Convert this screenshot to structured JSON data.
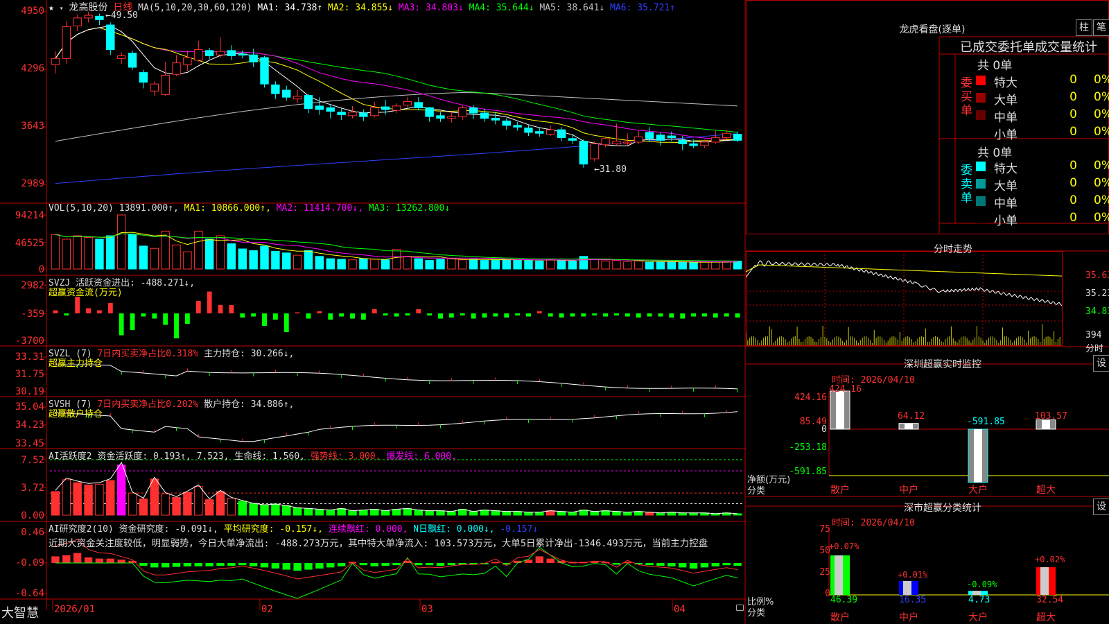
{
  "stock": {
    "name": "龙高股份",
    "period": "日线",
    "ma_label": "MA(5,10,20,30,60,120)",
    "ma": [
      {
        "label": "MA1: 34.738↑",
        "color": "#ffffff"
      },
      {
        "label": "MA2: 34.855↓",
        "color": "#ffff00"
      },
      {
        "label": "MA3: 34.803↓",
        "color": "#ff00ff"
      },
      {
        "label": "MA4: 35.644↓",
        "color": "#00ff00"
      },
      {
        "label": "MA5: 38.641↓",
        "color": "#c0c0c0"
      },
      {
        "label": "MA6: 35.721↑",
        "color": "#3040ff"
      }
    ],
    "high_marker": "49.50",
    "low_marker": "31.80"
  },
  "price_axis": [
    "4950",
    "4296",
    "3643",
    "2989"
  ],
  "vol_axis": [
    "94214",
    "46525",
    "0"
  ],
  "svzj_axis": [
    "2982",
    "-359",
    "-3700"
  ],
  "svzl_axis": [
    "33.31",
    "31.75",
    "30.19"
  ],
  "svsh_axis": [
    "35.04",
    "34.23",
    "33.45"
  ],
  "ai_axis": [
    "7.52",
    "3.72",
    "0.00"
  ],
  "ai2_axis": [
    "0.46",
    "-0.09",
    "-0.64"
  ],
  "date_axis": [
    "2026/01",
    "02",
    "03",
    "04"
  ],
  "brand": "大智慧",
  "vol_panel": {
    "title": "VOL(5,10,20)",
    "value": "13891.000↑,",
    "ma1": "MA1: 10866.000↑,",
    "ma2": "MA2: 11414.700↓,",
    "ma3": "MA3: 13262.800↓"
  },
  "svzj_panel": {
    "title": "SVZJ",
    "desc": "活跃资金进出: -488.271↓,",
    "sub": "超赢资金流(万元)"
  },
  "svzl_panel": {
    "title": "SVZL (7)",
    "desc": "7日内买卖净占比0.318%",
    "hold": "主力持仓: 30.266↓,",
    "sub": "超赢主力持仓"
  },
  "svsh_panel": {
    "title": "SVSH (7)",
    "desc": "7日内买卖净占比0.202%",
    "hold": "散户持仓: 34.886↑,",
    "sub": "超赢散户持仓"
  },
  "ai_panel": {
    "title": "AI活跃度2",
    "v1": "资金活跃度: 0.193↑, 7.523,",
    "v2": "生命线: 1.560,",
    "v3": "强势线: 3.000,",
    "v4": "爆发线: 6.000,"
  },
  "ai2_panel": {
    "title": "AI研究度2(10)",
    "v1": "资金研究度: -0.091↓,",
    "v2": "平均研究度: -0.157↓,",
    "v3": "连续飘红: 0.000,",
    "v4": "N日飘红: 0.000↓,",
    "v5": "-0.157↓",
    "commentary": "近期大资金关注度较低，明显弱势，今日大单净流出: -488.273万元，其中特大单净流入: 103.573万元，大单5日累计净出-1346.493万元，当前主力控盘"
  },
  "right": {
    "lhkp_title": "龙虎看盘(逐单)",
    "btn_zhu": "柱",
    "btn_bi": "笔",
    "tabs": "已成交委托单成交量统计",
    "buy_label": "委买单",
    "sell_label": "委卖单",
    "buy_total": "共 0单",
    "sell_total": "共 0单",
    "buy_rows": [
      {
        "name": "特大",
        "count": "0",
        "pct": "0%",
        "color": "#ff0000"
      },
      {
        "name": "大单",
        "count": "0",
        "pct": "0%",
        "color": "#990000"
      },
      {
        "name": "中单",
        "count": "0",
        "pct": "0%",
        "color": "#660000"
      },
      {
        "name": "小单",
        "count": "0",
        "pct": "0%",
        "color": "#000000"
      }
    ],
    "sell_rows": [
      {
        "name": "特大",
        "count": "0",
        "pct": "0%",
        "color": "#00ffff"
      },
      {
        "name": "大单",
        "count": "0",
        "pct": "0%",
        "color": "#009999"
      },
      {
        "name": "中单",
        "count": "0",
        "pct": "0%",
        "color": "#007777"
      },
      {
        "name": "小单",
        "count": "0",
        "pct": "0%",
        "color": "#000000"
      }
    ],
    "fs_title": "分时走势",
    "fs_axis": [
      "35.63",
      "35.23",
      "34.83"
    ],
    "fs_vol": "394",
    "fs_vol_unit": "分时",
    "sz_title": "深圳超赢实时监控",
    "sz_btn": "设",
    "sz_time": "时间: 2026/04/10",
    "sz_axis": [
      "424.16",
      "85.49",
      "0",
      "-253.18",
      "-591.85"
    ],
    "sz_unit": "净额(万元)",
    "sz_cat": "分类",
    "sz_values": [
      "424.16",
      "64.12",
      "-591.85",
      "103.57"
    ],
    "sz_categories": [
      "散户",
      "中户",
      "大户",
      "超大"
    ],
    "sc_title": "深市超赢分类统计",
    "sc_btn": "设",
    "sc_time": "时间: 2026/04/10",
    "sc_axis": [
      "75",
      "50",
      "25",
      "0"
    ],
    "sc_unit": "比例%",
    "sc_cat": "分类",
    "sc_changes": [
      "+0.07%",
      "+0.01%",
      "-0.09%",
      "+0.02%"
    ],
    "sc_values": [
      "46.39",
      "16.35",
      "4.73",
      "32.54"
    ],
    "sc_categories": [
      "散户",
      "中户",
      "大户",
      "超大"
    ]
  },
  "chart_data": [
    {
      "type": "candlestick",
      "title": "龙高股份 日线",
      "ylim": [
        29.89,
        49.5
      ],
      "candles": [
        [
          43.5,
          44.2,
          45.0,
          42.5
        ],
        [
          44.2,
          47.8,
          48.4,
          43.6
        ],
        [
          47.9,
          48.8,
          49.2,
          47.3
        ],
        [
          48.8,
          49.1,
          49.5,
          48.3
        ],
        [
          49.0,
          48.6,
          49.3,
          48.0
        ],
        [
          48.0,
          45.2,
          48.3,
          44.6
        ],
        [
          44.2,
          44.5,
          44.9,
          43.6
        ],
        [
          44.8,
          43.2,
          45.1,
          42.9
        ],
        [
          42.6,
          41.5,
          42.9,
          40.8
        ],
        [
          40.5,
          41.3,
          41.6,
          39.9
        ],
        [
          40.1,
          42.3,
          43.8,
          39.9
        ],
        [
          42.4,
          43.7,
          44.6,
          42.2
        ],
        [
          43.5,
          44.3,
          45.1,
          42.8
        ],
        [
          44.0,
          45.2,
          46.2,
          43.8
        ],
        [
          45.1,
          44.5,
          45.4,
          44.1
        ],
        [
          44.6,
          45.0,
          46.6,
          44.3
        ],
        [
          45.1,
          44.5,
          45.7,
          44.0
        ],
        [
          44.7,
          44.6,
          45.1,
          44.2
        ],
        [
          44.6,
          43.8,
          45.3,
          43.2
        ],
        [
          44.3,
          41.3,
          44.5,
          40.9
        ],
        [
          41.2,
          40.2,
          41.6,
          39.6
        ],
        [
          40.6,
          39.8,
          41.1,
          39.4
        ],
        [
          39.6,
          39.9,
          40.6,
          39.1
        ],
        [
          40.0,
          38.5,
          40.2,
          38.0
        ],
        [
          38.8,
          38.4,
          39.8,
          37.8
        ],
        [
          38.6,
          38.2,
          38.9,
          37.4
        ],
        [
          38.1,
          37.8,
          38.5,
          37.2
        ],
        [
          37.7,
          38.1,
          38.8,
          37.4
        ],
        [
          38.0,
          37.6,
          38.4,
          37.1
        ],
        [
          37.7,
          38.6,
          39.3,
          37.5
        ],
        [
          38.7,
          38.4,
          39.5,
          37.8
        ],
        [
          38.3,
          38.8,
          39.1,
          38.0
        ],
        [
          38.9,
          39.3,
          39.8,
          38.6
        ],
        [
          39.2,
          38.6,
          39.8,
          38.3
        ],
        [
          38.6,
          37.6,
          38.7,
          37.0
        ],
        [
          37.7,
          37.4,
          38.1,
          37.0
        ],
        [
          37.4,
          37.6,
          38.2,
          36.9
        ],
        [
          37.6,
          38.6,
          38.9,
          37.2
        ],
        [
          38.6,
          38.0,
          38.9,
          37.3
        ],
        [
          38.0,
          37.4,
          38.5,
          37.0
        ],
        [
          37.4,
          37.2,
          38.1,
          36.7
        ],
        [
          37.1,
          36.6,
          37.4,
          36.1
        ],
        [
          36.6,
          36.4,
          37.0,
          36.0
        ],
        [
          36.3,
          35.8,
          36.6,
          35.4
        ],
        [
          35.9,
          35.7,
          36.4,
          35.3
        ],
        [
          35.6,
          36.1,
          36.6,
          35.4
        ],
        [
          36.1,
          35.2,
          36.4,
          34.8
        ],
        [
          35.1,
          34.9,
          35.5,
          34.5
        ],
        [
          34.8,
          32.2,
          35.0,
          31.8
        ],
        [
          32.8,
          34.5,
          34.8,
          32.5
        ],
        [
          34.4,
          35.1,
          35.2,
          34.1
        ],
        [
          34.5,
          34.8,
          36.8,
          34.2
        ],
        [
          34.6,
          34.7,
          35.7,
          34.3
        ],
        [
          34.7,
          35.3,
          36.0,
          34.5
        ],
        [
          35.8,
          35.1,
          36.4,
          34.7
        ],
        [
          35.5,
          34.9,
          35.8,
          34.3
        ],
        [
          35.4,
          35.2,
          35.9,
          34.8
        ],
        [
          34.9,
          34.5,
          35.4,
          33.8
        ],
        [
          34.5,
          34.3,
          35.0,
          34.0
        ],
        [
          34.3,
          34.7,
          35.0,
          34.0
        ],
        [
          34.7,
          35.2,
          36.0,
          34.5
        ],
        [
          35.2,
          35.7,
          36.1,
          35.0
        ],
        [
          35.6,
          34.9,
          35.9,
          34.7
        ]
      ]
    },
    {
      "type": "bar",
      "title": "VOL(5,10,20)",
      "ylim": [
        0,
        94214
      ],
      "values": [
        60000,
        52000,
        58000,
        55000,
        52000,
        58000,
        94214,
        60000,
        40000,
        36000,
        66000,
        42000,
        30000,
        66000,
        52000,
        58000,
        44000,
        35000,
        32000,
        40000,
        31000,
        28000,
        24000,
        32000,
        22000,
        18000,
        17000,
        16000,
        18000,
        17000,
        16000,
        34000,
        22000,
        18000,
        15000,
        17000,
        18000,
        16000,
        17000,
        15000,
        16000,
        17000,
        16000,
        15000,
        14000,
        17000,
        15000,
        14000,
        22000,
        17000,
        14000,
        15000,
        13000,
        14000,
        12000,
        12000,
        13000,
        12000,
        11000,
        12000,
        12000,
        13000,
        13891
      ]
    },
    {
      "type": "bar",
      "title": "AI活跃度2",
      "ylim": [
        0,
        7.52
      ],
      "values": [
        3.2,
        4.8,
        4.4,
        4.1,
        4.2,
        4.7,
        6.8,
        3.0,
        2.2,
        4.9,
        2.9,
        2.4,
        3.1,
        3.9,
        2.1,
        3.2,
        2.3,
        1.9,
        1.6,
        1.4,
        1.5,
        1.3,
        1.0,
        0.9,
        0.8,
        0.7,
        0.9,
        0.6,
        0.7,
        0.8,
        0.6,
        0.8,
        0.9,
        0.7,
        0.6,
        0.6,
        0.5,
        0.8,
        0.5,
        0.7,
        0.6,
        0.5,
        0.5,
        0.4,
        0.4,
        0.6,
        0.5,
        0.4,
        0.7,
        0.5,
        0.6,
        0.5,
        0.4,
        0.5,
        0.4,
        0.3,
        0.4,
        0.3,
        0.3,
        0.3,
        0.2,
        0.3,
        0.193
      ]
    }
  ]
}
